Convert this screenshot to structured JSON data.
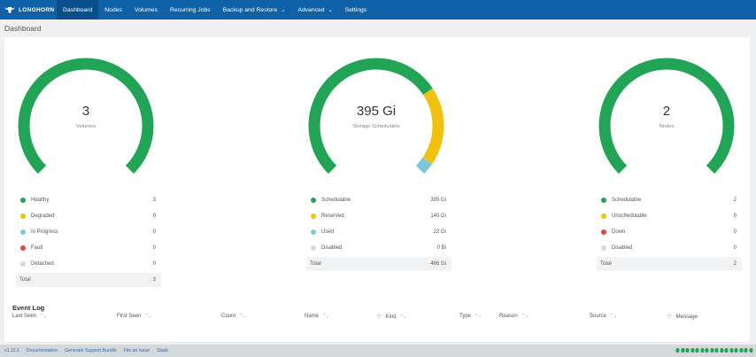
{
  "app": {
    "logo_text": "LONGHORN"
  },
  "nav": {
    "dashboard": "Dashboard",
    "nodes": "Nodes",
    "volumes": "Volumes",
    "recurring_jobs": "Recurring Jobs",
    "backup_restore": "Backup and Restore",
    "advanced": "Advanced",
    "settings": "Settings"
  },
  "page": {
    "title": "Dashboard"
  },
  "colors": {
    "healthy": "#21a455",
    "warning": "#f0c20f",
    "info": "#7cc8d6",
    "danger": "#e04a3c",
    "muted": "#d9d9d9",
    "nav": "#0f62a8"
  },
  "volumes": {
    "value": "3",
    "label": "Volumes",
    "gauge": {
      "healthy": 3,
      "degraded": 0,
      "in_progress": 0,
      "fault": 0,
      "detached": 0
    },
    "legend": [
      {
        "label": "Healthy",
        "value": "3",
        "color": "#21a455"
      },
      {
        "label": "Degraded",
        "value": "0",
        "color": "#f0c20f"
      },
      {
        "label": "In Progress",
        "value": "0",
        "color": "#7cc8d6"
      },
      {
        "label": "Fault",
        "value": "0",
        "color": "#e04a3c"
      },
      {
        "label": "Detached",
        "value": "0",
        "color": "#d9d9d9"
      }
    ],
    "total_label": "Total",
    "total_value": "3"
  },
  "storage": {
    "value": "395 Gi",
    "label": "Storage Schedulable",
    "gauge": {
      "schedulable": 395,
      "reserved": 140,
      "used": 22
    },
    "legend": [
      {
        "label": "Schedulable",
        "value": "395 Gi",
        "color": "#21a455"
      },
      {
        "label": "Reserved",
        "value": "140 Gi",
        "color": "#f0c20f"
      },
      {
        "label": "Used",
        "value": "22 Gi",
        "color": "#7cc8d6"
      },
      {
        "label": "Disabled",
        "value": "0 Bi",
        "color": "#d9d9d9"
      }
    ],
    "total_label": "Total",
    "total_value": "466 Gi"
  },
  "nodes": {
    "value": "2",
    "label": "Nodes",
    "gauge": {
      "schedulable": 2,
      "unschedulable": 0,
      "down": 0,
      "disabled": 0
    },
    "legend": [
      {
        "label": "Schedulable",
        "value": "2",
        "color": "#21a455"
      },
      {
        "label": "Unschedulable",
        "value": "0",
        "color": "#f0c20f"
      },
      {
        "label": "Down",
        "value": "0",
        "color": "#e04a3c"
      },
      {
        "label": "Disabled",
        "value": "0",
        "color": "#d9d9d9"
      }
    ],
    "total_label": "Total",
    "total_value": "2"
  },
  "event_log": {
    "title": "Event Log",
    "columns": [
      "Last Seen",
      "First Seen",
      "Count",
      "Name",
      "Kind",
      "Type",
      "Reason",
      "Source",
      "Message"
    ]
  },
  "footer": {
    "version": "v1.12.1",
    "documentation": "Documentation",
    "support_bundle": "Generate Support Bundle",
    "file_issue": "File an Issue",
    "slack": "Slack"
  }
}
